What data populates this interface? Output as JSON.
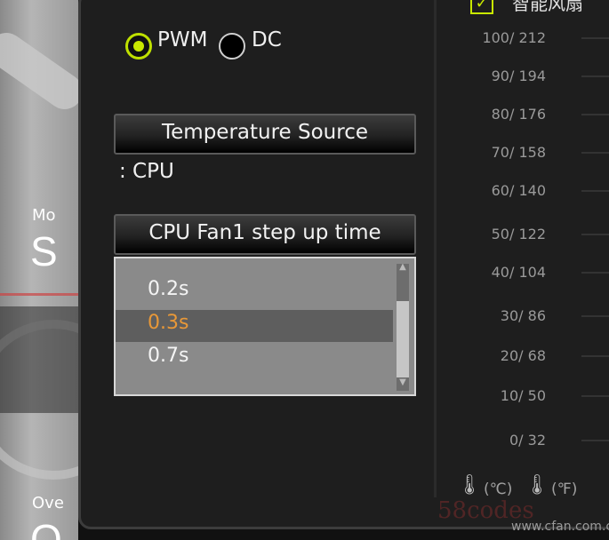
{
  "background_window": {
    "label_small_1": "Mo",
    "label_large_1": "S",
    "label_small_2": "Ove",
    "label_large_2": "O"
  },
  "fan_mode": {
    "options": [
      "PWM",
      "DC"
    ],
    "selected": "PWM"
  },
  "temperature_source": {
    "header": "Temperature Source",
    "value": ": CPU"
  },
  "step_up_time": {
    "header": "CPU Fan1 step up time",
    "options": [
      "0.2s",
      "0.3s",
      "0.7s"
    ],
    "selected": "0.3s"
  },
  "smart_fan": {
    "checked": true,
    "check_glyph": "✓",
    "label": "智能风扇"
  },
  "scale": {
    "rows": [
      "100/ 212",
      "90/ 194",
      "80/ 176",
      "70/ 158",
      "60/ 140",
      "50/ 122",
      "40/ 104",
      "30/  86",
      "20/  68",
      "10/  50",
      "0/  32"
    ],
    "unit_celsius": "(℃)",
    "unit_fahrenheit": "(℉)"
  },
  "watermark": {
    "text1": "58codes",
    "text2": "www.cfan.com.cn"
  },
  "colors": {
    "accent_green": "#c9e800",
    "selected_orange": "#e89838"
  }
}
